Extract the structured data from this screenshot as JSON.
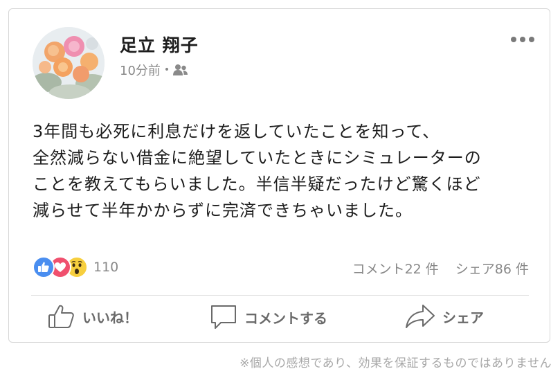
{
  "post": {
    "author_name": "足立 翔子",
    "timestamp": "10分前",
    "meta_separator": "•",
    "audience_icon": "friends-icon",
    "more_icon": "more-dots-icon",
    "body_lines": [
      "3年間も必死に利息だけを返していたことを知って、",
      "全然減らない借金に絶望していたときにシミュレーターの",
      "ことを教えてもらいました。半信半疑だったけど驚くほど",
      "減らせて半年かからずに完済できちゃいました。"
    ]
  },
  "reactions": {
    "icons": [
      "like-icon",
      "love-icon",
      "wow-icon"
    ],
    "colors": {
      "like": "#4a8ef0",
      "love": "#f0506e",
      "wow": "#f7cf3e"
    },
    "count": "110",
    "comments": "コメント22 件",
    "shares": "シェア86 件"
  },
  "actions": {
    "like_label": "いいね！",
    "comment_label": "コメントする",
    "share_label": "シェア"
  },
  "footer": {
    "disclaimer": "※個人の感想であり、効果を保証するものではありません"
  }
}
